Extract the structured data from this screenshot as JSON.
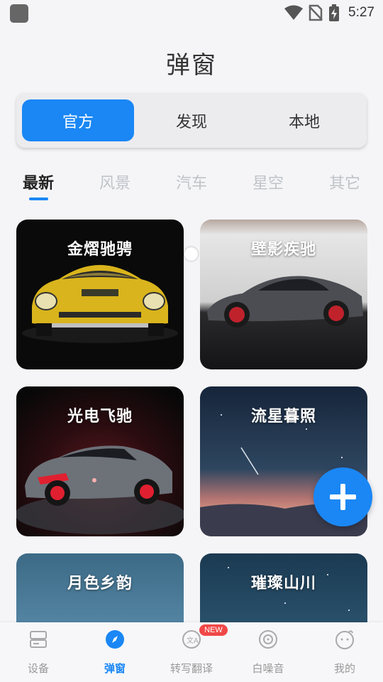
{
  "status_bar": {
    "time": "5:27"
  },
  "header": {
    "title": "弹窗"
  },
  "source_tabs": [
    {
      "label": "官方",
      "active": true
    },
    {
      "label": "发现",
      "active": false
    },
    {
      "label": "本地",
      "active": false
    }
  ],
  "category_tabs": [
    {
      "label": "最新",
      "active": true
    },
    {
      "label": "风景",
      "active": false
    },
    {
      "label": "汽车",
      "active": false
    },
    {
      "label": "星空",
      "active": false
    },
    {
      "label": "其它",
      "active": false
    }
  ],
  "cards": [
    {
      "title": "金熠驰骋",
      "image": "yellow-sports-car"
    },
    {
      "title": "壁影疾驰",
      "image": "grey-sports-car"
    },
    {
      "title": "光电飞驰",
      "image": "red-glow-sports-car"
    },
    {
      "title": "流星暮照",
      "image": "meteor-sunset-sky"
    },
    {
      "title": "月色乡韵",
      "image": "moonlit-sky"
    },
    {
      "title": "璀璨山川",
      "image": "starry-mountains"
    }
  ],
  "fab": {
    "icon": "plus-icon"
  },
  "bottom_nav": [
    {
      "label": "设备",
      "icon": "device-icon",
      "active": false
    },
    {
      "label": "弹窗",
      "icon": "compass-icon",
      "active": true
    },
    {
      "label": "转写翻译",
      "icon": "translate-icon",
      "active": false,
      "badge": "NEW"
    },
    {
      "label": "白噪音",
      "icon": "disc-icon",
      "active": false
    },
    {
      "label": "我的",
      "icon": "profile-icon",
      "active": false
    }
  ],
  "colors": {
    "accent": "#1a87f5",
    "badge": "#f04848",
    "inactive": "#999999"
  }
}
